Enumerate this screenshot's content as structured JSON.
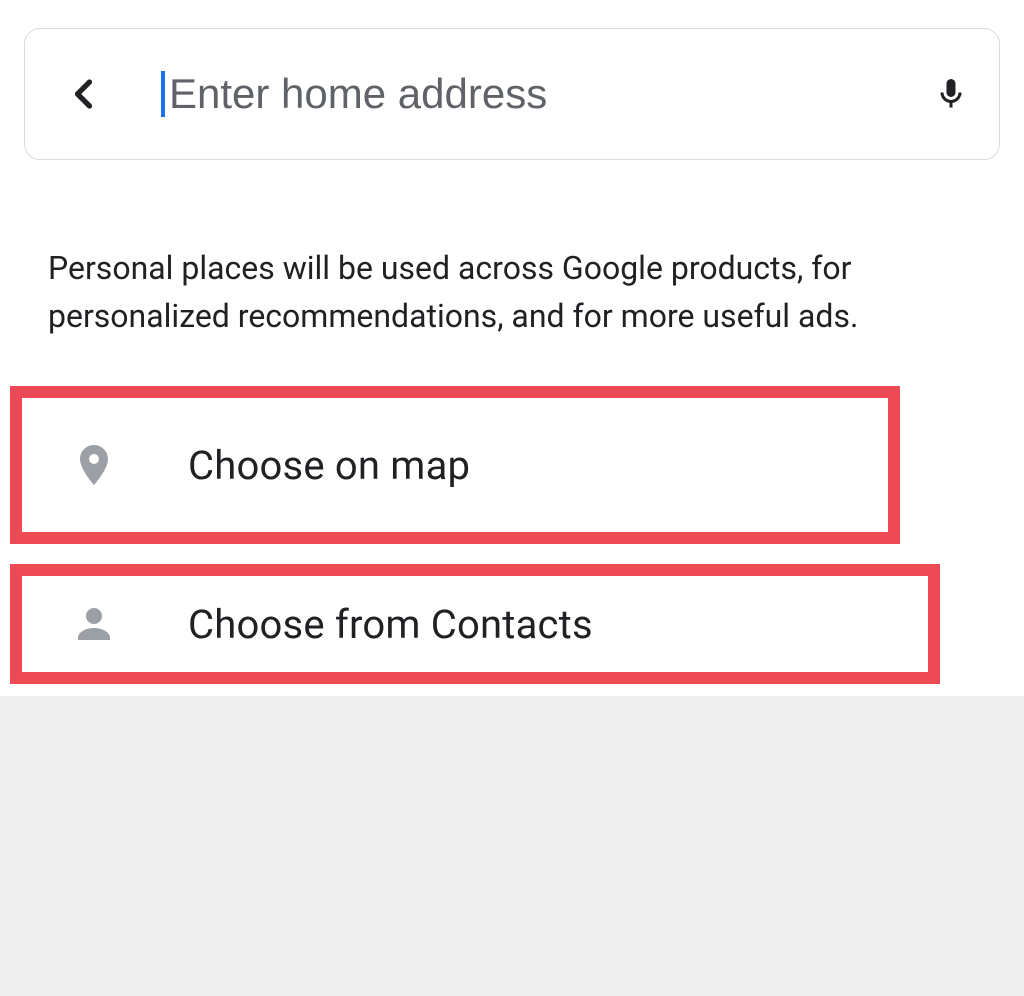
{
  "search": {
    "placeholder": "Enter home address",
    "value": ""
  },
  "info_text": "Personal places will be used across Google products, for personalized recommendations, and for more useful ads.",
  "options": {
    "choose_on_map": "Choose on map",
    "choose_from_contacts": "Choose from Contacts"
  }
}
